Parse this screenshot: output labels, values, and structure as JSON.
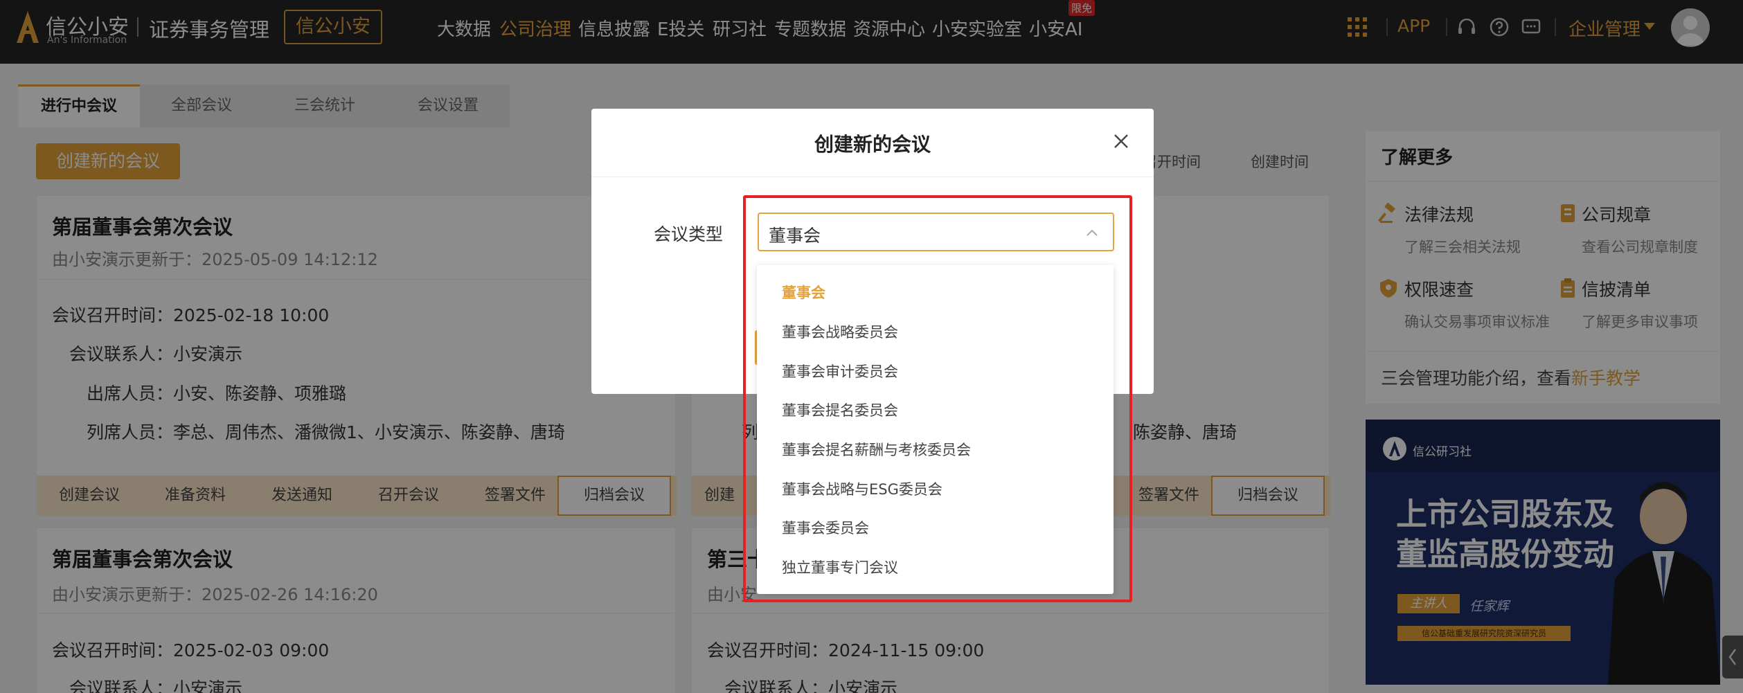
{
  "header": {
    "logo_cn": "信公小安",
    "logo_en": "An's Information",
    "system_title": "证券事务管理",
    "brand_button": "信公小安",
    "nav": [
      {
        "label": "大数据",
        "active": false
      },
      {
        "label": "公司治理",
        "active": true
      },
      {
        "label": "信息披露",
        "active": false
      },
      {
        "label": "E投关",
        "active": false
      },
      {
        "label": "研习社",
        "active": false
      },
      {
        "label": "专题数据",
        "active": false
      },
      {
        "label": "资源中心",
        "active": false
      },
      {
        "label": "小安实验室",
        "active": false
      },
      {
        "label": "小安AI",
        "active": false
      }
    ],
    "limit_badge": "限免",
    "app_label": "APP",
    "enterprise_menu": "企业管理"
  },
  "tabs": [
    "进行中会议",
    "全部会议",
    "三会统计",
    "会议设置"
  ],
  "create_button": "创建新的会议",
  "sort": {
    "meeting_time": "召开时间",
    "created_time": "创建时间"
  },
  "cards": [
    {
      "title": "第届董事会第次会议",
      "updated": "由小安演示更新于：2025-05-09 14:12:12",
      "rows": [
        {
          "label": "会议召开时间：",
          "value": "2025-02-18 10:00"
        },
        {
          "label": "会议联系人：",
          "value": "小安演示"
        },
        {
          "label": "出席人员：",
          "value": "小安、陈姿静、项雅璐"
        },
        {
          "label": "列席人员：",
          "value": "李总、周伟杰、潘微微1、小安演示、陈姿静、唐琦"
        }
      ]
    },
    {
      "title": "",
      "updated": "",
      "rows": [
        {
          "label": "列",
          "value": "陈姿静、唐琦"
        }
      ]
    },
    {
      "title": "第届董事会第次会议",
      "updated": "由小安演示更新于：2025-02-26 14:16:20",
      "rows": [
        {
          "label": "会议召开时间：",
          "value": "2025-02-03 09:00"
        },
        {
          "label": "会议联系人：",
          "value": "小安演示"
        }
      ]
    },
    {
      "title": "第三十",
      "updated": "由小安",
      "rows": [
        {
          "label": "会议召开时间：",
          "value": "2024-11-15 09:00"
        },
        {
          "label": "会议联系人：",
          "value": "小安演示"
        }
      ]
    }
  ],
  "steps": [
    "创建会议",
    "准备资料",
    "发送通知",
    "召开会议",
    "签署文件",
    "归档会议"
  ],
  "steps_partial": [
    "创建",
    "签署文件",
    "归档会议"
  ],
  "aside": {
    "title": "了解更多",
    "items": [
      {
        "label": "法律法规",
        "desc": "了解三会相关法规",
        "icon": "gavel-icon"
      },
      {
        "label": "公司规章",
        "desc": "查看公司规章制度",
        "icon": "regulation-icon"
      },
      {
        "label": "权限速查",
        "desc": "确认交易事项审议标准",
        "icon": "shield-icon"
      },
      {
        "label": "信披清单",
        "desc": "了解更多审议事项",
        "icon": "clipboard-icon"
      }
    ],
    "footer_text": "三会管理功能介绍，查看",
    "footer_link": "新手教学"
  },
  "banner": {
    "brand": "信公研习社",
    "headline_1": "上市公司股东及",
    "headline_2": "董监高股份变动",
    "tag": "主讲人",
    "speaker": "任家辉",
    "small_text": "信公基础重发展研究院资深研究员"
  },
  "modal": {
    "title": "创建新的会议",
    "field_label": "会议类型",
    "selected_value": "董事会",
    "options": [
      "董事会",
      "董事会战略委员会",
      "董事会审计委员会",
      "董事会提名委员会",
      "董事会提名薪酬与考核委员会",
      "董事会战略与ESG委员会",
      "董事会委员会",
      "独立董事专门会议"
    ]
  },
  "colors": {
    "accent": "#e3a23b",
    "topbar": "#262626",
    "highlight": "#e62121"
  }
}
